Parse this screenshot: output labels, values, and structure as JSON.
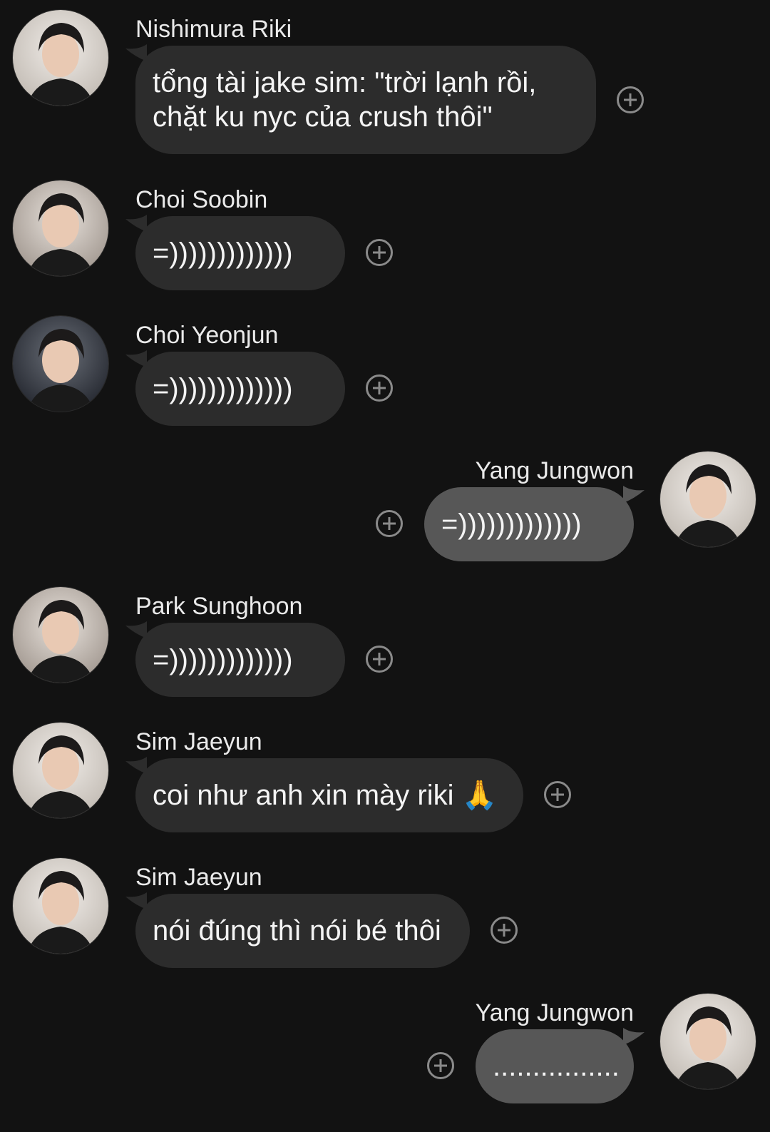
{
  "colors": {
    "background": "#121212",
    "incoming_bubble": "#2c2c2c",
    "outgoing_bubble": "#575757",
    "react_icon": "#8a8a8a"
  },
  "messages": [
    {
      "sender": "Nishimura Riki",
      "text": "tổng tài jake sim: \"trời lạnh rồi,\nchặt ku nyc của crush thôi\"",
      "direction": "incoming",
      "react_icon": "add-reaction-icon"
    },
    {
      "sender": "Choi Soobin",
      "text": "=)))))))))))))",
      "direction": "incoming",
      "react_icon": "add-reaction-icon"
    },
    {
      "sender": "Choi Yeonjun",
      "text": "=)))))))))))))",
      "direction": "incoming",
      "react_icon": "add-reaction-icon"
    },
    {
      "sender": "Yang Jungwon",
      "text": "=)))))))))))))",
      "direction": "outgoing",
      "react_icon": "add-reaction-icon"
    },
    {
      "sender": "Park Sunghoon",
      "text": "=)))))))))))))",
      "direction": "incoming",
      "react_icon": "add-reaction-icon"
    },
    {
      "sender": "Sim Jaeyun",
      "text": "coi như anh xin mày riki 🙏",
      "direction": "incoming",
      "react_icon": "add-reaction-icon"
    },
    {
      "sender": "Sim Jaeyun",
      "text": "nói đúng thì nói bé thôi",
      "direction": "incoming",
      "react_icon": "add-reaction-icon"
    },
    {
      "sender": "Yang Jungwon",
      "text": "................",
      "direction": "outgoing",
      "react_icon": "add-reaction-icon"
    }
  ]
}
